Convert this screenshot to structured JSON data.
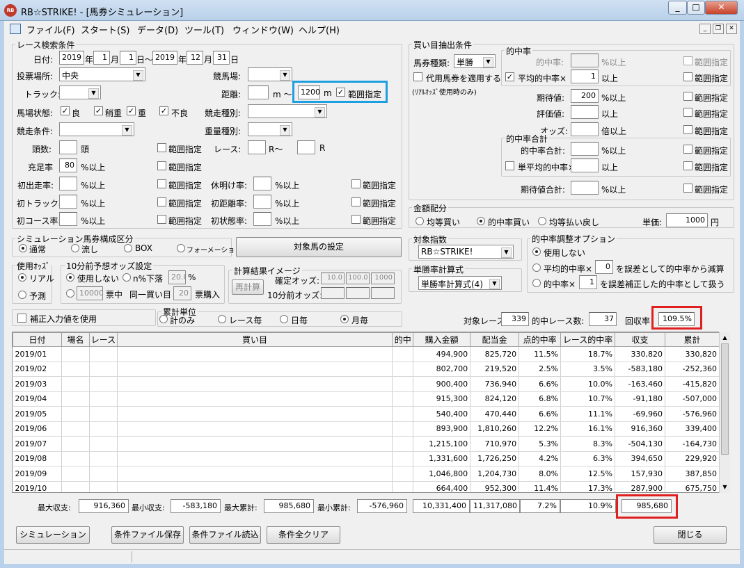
{
  "window": {
    "title": "RB☆STRIKE! - [馬券シミュレーション]",
    "icon_text": "RB"
  },
  "menu": [
    "ファイル(F)",
    "スタート(S)",
    "データ(D)",
    "ツール(T)",
    "ウィンドウ(W)",
    "ヘルプ(H)"
  ],
  "race_search": {
    "group_title": "レース検索条件",
    "date_label": "日付:",
    "from_year": "2019",
    "year_unit": "年",
    "from_month": "1",
    "month_unit": "月",
    "from_day": "1",
    "day_range": "日～",
    "to_year": "2019",
    "to_month": "12",
    "to_day": "31",
    "day_unit": "日",
    "venue_label": "投票場所:",
    "venue": "中央",
    "course_label": "競馬場:",
    "track_label": "トラック:",
    "distance_label": "距離:",
    "distance_unit": "m ～",
    "distance_to": "1200",
    "distance_to_unit": "m",
    "range_label": "範囲指定",
    "condition_label": "馬場状態:",
    "cond_good": "良",
    "cond_slightly": "稍重",
    "cond_heavy": "重",
    "cond_bad": "不良",
    "race_type_label": "競走種別:",
    "race_cond_label": "競走条件:",
    "weight_type_label": "重量種別:",
    "head_label": "頭数:",
    "head_unit": "頭",
    "race_label": "レース:",
    "race_unit": "R～",
    "race_unit2": "R",
    "fill_label": "充足率",
    "fill_value": "80",
    "pct_above": "%以上",
    "first_run_label": "初出走率:",
    "rest_label": "休明け率:",
    "first_track_label": "初トラック率:",
    "first_dist_label": "初距離率:",
    "first_course_label": "初コース率:",
    "first_state_label": "初状態率:"
  },
  "sim_type": {
    "group_title": "シミュレーション馬券構成区分",
    "options": [
      "通常",
      "流し",
      "BOX",
      "フォーメーション"
    ],
    "selected": 0,
    "target_button": "対象馬の設定"
  },
  "odds_use": {
    "group_title": "使用ｵｯｽﾞ",
    "options": [
      "リアル",
      "予測"
    ],
    "selected": 0
  },
  "odds10": {
    "group_title": "10分前予想オッズ設定",
    "opt_none": "使用しない",
    "opt_drop": "n%下落",
    "drop_value": "20.0",
    "pct": "%",
    "amount": "10000",
    "amount_label": "票中",
    "same_label": "同一買い目",
    "same_value": "20",
    "buy_label": "票購入"
  },
  "calc_image": {
    "group_title": "計算結果イメージ",
    "recalc": "再計算",
    "confirmed_label": "確定オッズ:",
    "confirmed_values": [
      "10.0",
      "100.0",
      "1000"
    ],
    "before_label": "10分前オッズ:"
  },
  "correct_label": "補正入力値を使用",
  "aggregate": {
    "group_title": "累計単位",
    "options": [
      "計のみ",
      "レース毎",
      "日毎",
      "月毎"
    ],
    "selected": 3
  },
  "buy_extract": {
    "group_title": "買い目抽出条件",
    "ticket_label": "馬券種類:",
    "ticket": "単勝",
    "substitute_label": "代用馬券を適用する",
    "substitute_note": "(ﾘｱﾙｵｯｽﾞ使用時のみ)"
  },
  "hit_rate": {
    "group_title": "的中率",
    "hit_label": "的中率:",
    "avg_label": "平均的中率×",
    "avg_value": "1",
    "above": "以上",
    "pct_above": "%以上",
    "expect_label": "期待値:",
    "expect_value": "200",
    "eval_label": "評価値:",
    "odds_label": "オッズ:",
    "times_above": "倍以上",
    "range_label": "範囲指定"
  },
  "hit_total": {
    "group_title": "的中率合計",
    "total_label": "的中率合計:",
    "single_avg_label": "単平均的中率×",
    "above": "以上",
    "pct_above": "%以上",
    "expect_total_label": "期待値合計:"
  },
  "money": {
    "group_title": "金額配分",
    "options": [
      "均等買い",
      "的中率買い",
      "均等払い戻し"
    ],
    "selected": 1,
    "unit_label": "単価:",
    "unit_value": "1000",
    "yen": "円"
  },
  "target_index": {
    "group_title": "対象指数",
    "value": "RB☆STRIKE!"
  },
  "win_rate": {
    "group_title": "単勝率計算式",
    "value": "単勝率計算式(4)"
  },
  "adjust": {
    "group_title": "的中率調整オプション",
    "opt_none": "使用しない",
    "opt_avg_prefix": "平均的中率×",
    "opt_avg_value": "0",
    "opt_avg_suffix": "を誤差として的中率から減算",
    "opt_hit_prefix": "的中率×",
    "opt_hit_value": "1",
    "opt_hit_suffix": "を誤差補正した的中率として扱う"
  },
  "stats": {
    "races_label": "対象レース数:",
    "races": "339",
    "hit_label": "的中レース数:",
    "hits": "37",
    "recovery_label": "回収率",
    "recovery": "109.5%"
  },
  "table": {
    "headers": [
      "日付",
      "場名",
      "レース",
      "買い目",
      "的中",
      "購入金額",
      "配当金",
      "点的中率",
      "レース的中率",
      "収支",
      "累計"
    ],
    "rows": [
      [
        "2019/01",
        "",
        "",
        "",
        "",
        "494,900",
        "825,720",
        "11.5%",
        "18.7%",
        "330,820",
        "330,820"
      ],
      [
        "2019/02",
        "",
        "",
        "",
        "",
        "802,700",
        "219,520",
        "2.5%",
        "3.5%",
        "-583,180",
        "-252,360"
      ],
      [
        "2019/03",
        "",
        "",
        "",
        "",
        "900,400",
        "736,940",
        "6.6%",
        "10.0%",
        "-163,460",
        "-415,820"
      ],
      [
        "2019/04",
        "",
        "",
        "",
        "",
        "915,300",
        "824,120",
        "6.8%",
        "10.7%",
        "-91,180",
        "-507,000"
      ],
      [
        "2019/05",
        "",
        "",
        "",
        "",
        "540,400",
        "470,440",
        "6.6%",
        "11.1%",
        "-69,960",
        "-576,960"
      ],
      [
        "2019/06",
        "",
        "",
        "",
        "",
        "893,900",
        "1,810,260",
        "12.2%",
        "16.1%",
        "916,360",
        "339,400"
      ],
      [
        "2019/07",
        "",
        "",
        "",
        "",
        "1,215,100",
        "710,970",
        "5.3%",
        "8.3%",
        "-504,130",
        "-164,730"
      ],
      [
        "2019/08",
        "",
        "",
        "",
        "",
        "1,331,600",
        "1,726,250",
        "4.2%",
        "6.3%",
        "394,650",
        "229,920"
      ],
      [
        "2019/09",
        "",
        "",
        "",
        "",
        "1,046,800",
        "1,204,730",
        "8.0%",
        "12.5%",
        "157,930",
        "387,850"
      ],
      [
        "2019/10",
        "",
        "",
        "",
        "",
        "664,400",
        "952,300",
        "11.4%",
        "17.3%",
        "287,900",
        "675,750"
      ]
    ]
  },
  "summary": {
    "max_label": "最大収支:",
    "max": "916,360",
    "min_label": "最小収支:",
    "min": "-583,180",
    "max_total_label": "最大累計:",
    "max_total": "985,680",
    "min_total_label": "最小累計:",
    "min_total": "-576,960",
    "purchase": "10,331,400",
    "payout": "11,317,080",
    "point_rate": "7.2%",
    "race_rate": "10.9%",
    "balance": "985,680"
  },
  "buttons": {
    "simulate": "シミュレーション",
    "save": "条件ファイル保存",
    "load": "条件ファイル読込",
    "clear": "条件全クリア",
    "close": "閉じる"
  },
  "colors": {
    "highlight_blue": "#1ea0e0",
    "highlight_red": "#e02020"
  }
}
